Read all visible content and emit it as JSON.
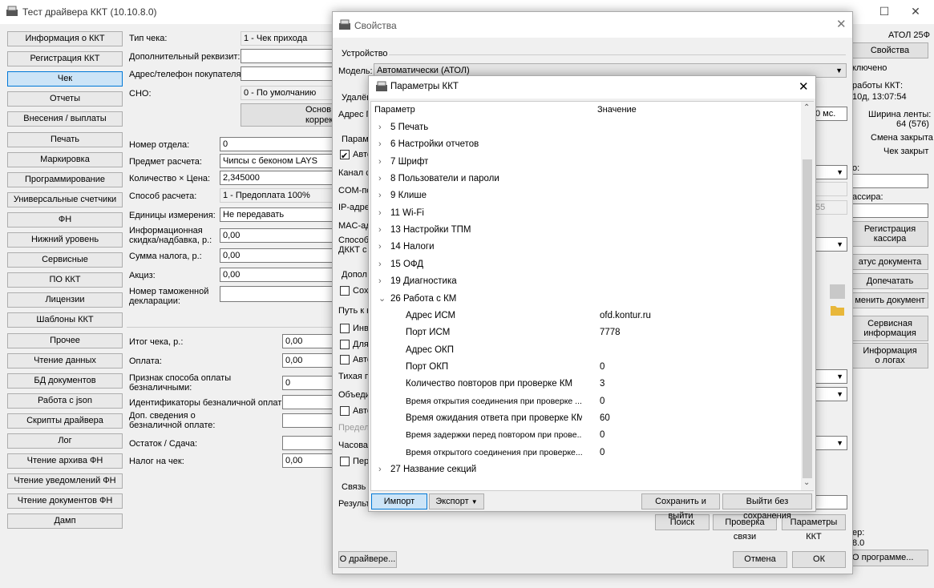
{
  "app": {
    "title": "Тест драйвера ККТ (10.10.8.0)"
  },
  "nav": [
    "Информация о ККТ",
    "Регистрация ККТ",
    "Чек",
    "Отчеты",
    "Внесения / выплаты",
    "Печать",
    "Маркировка",
    "Программирование",
    "Универсальные счетчики",
    "ФН",
    "Нижний уровень",
    "Сервисные",
    "ПО ККТ",
    "Лицензии",
    "Шаблоны ККТ",
    "Прочее",
    "Чтение данных",
    "БД документов",
    "Работа с json",
    "Скрипты драйвера",
    "Лог",
    "Чтение архива ФН",
    "Чтение уведомлений ФН",
    "Чтение документов ФН",
    "Дамп"
  ],
  "check": {
    "type_label": "Тип чека:",
    "type_value": "1 - Чек прихода",
    "extra_label": "Дополнительный реквизит:",
    "buyer_label": "Адрес/телефон покупателя:",
    "sno_label": "СНО:",
    "sno_value": "0 - По умолчанию",
    "basis_btn_1": "Основ",
    "basis_btn_2": "коррек",
    "dept_label": "Номер отдела:",
    "dept_value": "0",
    "item_label": "Предмет расчета:",
    "item_value": "Чипсы с беконом LAYS",
    "qty_label": "Количество × Цена:",
    "qty_value": "2,345000",
    "method_label": "Способ расчета:",
    "method_value": "1 - Предоплата 100%",
    "units_label": "Единицы измерения:",
    "units_value": "Не передавать",
    "discount_label": "Информационная скидка/надбавка, р.:",
    "discount_value": "0,00",
    "tax_label": "Сумма налога, р.:",
    "tax_value": "0,00",
    "excise_label": "Акциз:",
    "excise_value": "0,00",
    "customs_label": "Номер таможенной декларации:",
    "total_label": "Итог чека, р.:",
    "total_value": "0,00",
    "pay_label": "Оплата:",
    "pay_value": "0,00",
    "cashless_label": "Признак способа оплаты безналичными:",
    "cashless_value": "0",
    "cashless_id_label": "Идентификаторы безналичной оплаты:",
    "cashless_info_label": "Доп. сведения о безналичной оплате:",
    "change_label": "Остаток / Сдача:",
    "tax_on_check_label": "Налог на чек:",
    "tax_on_check_value": "0,00"
  },
  "right_panel": {
    "model": "АТОЛ 25Ф",
    "props_btn": "Свойства",
    "connected": "ключено",
    "work_label": "работы ККТ:",
    "work_value": "10д, 13:07:54",
    "tape_label": "Ширина ленты:",
    "tape_value": "64 (576)",
    "shift": "Смена закрыта",
    "check_state": "Чек закрыт",
    "o_label": "о:",
    "cashier_label": "ассира:",
    "reg_cashier_btn_1": "Регистрация",
    "reg_cashier_btn_2": "кассира",
    "doc_status_btn": "атус документа",
    "reprint_btn": "Допечатать",
    "cancel_doc_btn": "менить документ",
    "service_btn_1": "Сервисная",
    "service_btn_2": "информация",
    "logs_btn_1": "Информация",
    "logs_btn_2": "о логах",
    "ver_label": "ер:",
    "ver_value": "8.0",
    "about_btn": "О программе..."
  },
  "props": {
    "title": "Свойства",
    "device_group": "Устройство",
    "model_label": "Модель:",
    "model_value": "Автоматически (АТОЛ)",
    "remote_label": "Удалён",
    "addr_label": "Адрес П",
    "ms_value": "0 мс.",
    "params_label": "Параме",
    "auto_label": "Авто",
    "channel_label": "Канал с",
    "com_label": "COM-по",
    "ip_label": "IP-адре",
    "ip_value": "55",
    "mac_label": "MAC-ад",
    "way_label": "Способ",
    "dkkt_label": "ДККТ с",
    "extra_label": "Допол",
    "save_label": "Сохр",
    "path_label": "Путь к н",
    "inv_label": "Инве",
    "for_label": "Для",
    "auto2_label": "Авто",
    "quiet_label": "Тихая п",
    "combine_label": "Объеди",
    "auto3_label": "Авто",
    "limit_label": "Предел",
    "hourly_label": "Часовая",
    "reb_label": "Пере",
    "link_group": "Связь",
    "result_label": "Результ",
    "search_btn": "Поиск",
    "check_link_btn": "Проверка связи",
    "kkt_params_btn": "Параметры ККТ",
    "about_driver_btn": "О драйвере...",
    "cancel_btn": "Отмена",
    "ok_btn": "ОК"
  },
  "params": {
    "title": "Параметры ККТ",
    "col_param": "Параметр",
    "col_value": "Значение",
    "rows": [
      {
        "name": "5 Печать",
        "value": "",
        "chev": "›"
      },
      {
        "name": "6 Настройки отчетов",
        "value": "",
        "chev": "›"
      },
      {
        "name": "7 Шрифт",
        "value": "",
        "chev": "›"
      },
      {
        "name": "8 Пользователи и пароли",
        "value": "",
        "chev": "›"
      },
      {
        "name": "9 Клише",
        "value": "",
        "chev": "›"
      },
      {
        "name": "11 Wi-Fi",
        "value": "",
        "chev": "›"
      },
      {
        "name": "13 Настройки ТПМ",
        "value": "",
        "chev": "›"
      },
      {
        "name": "14 Налоги",
        "value": "",
        "chev": "›"
      },
      {
        "name": "15 ОФД",
        "value": "",
        "chev": "›"
      },
      {
        "name": "19 Диагностика",
        "value": "",
        "chev": "›"
      },
      {
        "name": "26 Работа с КМ",
        "value": "",
        "chev": "⌄"
      },
      {
        "name": "Адрес ИСМ",
        "value": "ofd.kontur.ru",
        "chev": ""
      },
      {
        "name": "Порт ИСМ",
        "value": "7778",
        "chev": ""
      },
      {
        "name": "Адрес ОКП",
        "value": "",
        "chev": ""
      },
      {
        "name": "Порт ОКП",
        "value": "0",
        "chev": ""
      },
      {
        "name": "Количество повторов при проверке КМ",
        "value": "3",
        "chev": ""
      },
      {
        "name": "Время открытия соединения при проверке ...",
        "value": "0",
        "chev": ""
      },
      {
        "name": "Время ожидания ответа при проверке КМ",
        "value": "60",
        "chev": ""
      },
      {
        "name": "Время задержки перед повтором при прове...",
        "value": "0",
        "chev": ""
      },
      {
        "name": "Время открытого соединения при проверке...",
        "value": "0",
        "chev": ""
      },
      {
        "name": "27 Название секций",
        "value": "",
        "chev": "›"
      }
    ],
    "import_btn": "Импорт",
    "export_btn": "Экспорт",
    "save_exit_btn": "Сохранить и выйти",
    "exit_nosave_btn": "Выйти без сохранения"
  }
}
